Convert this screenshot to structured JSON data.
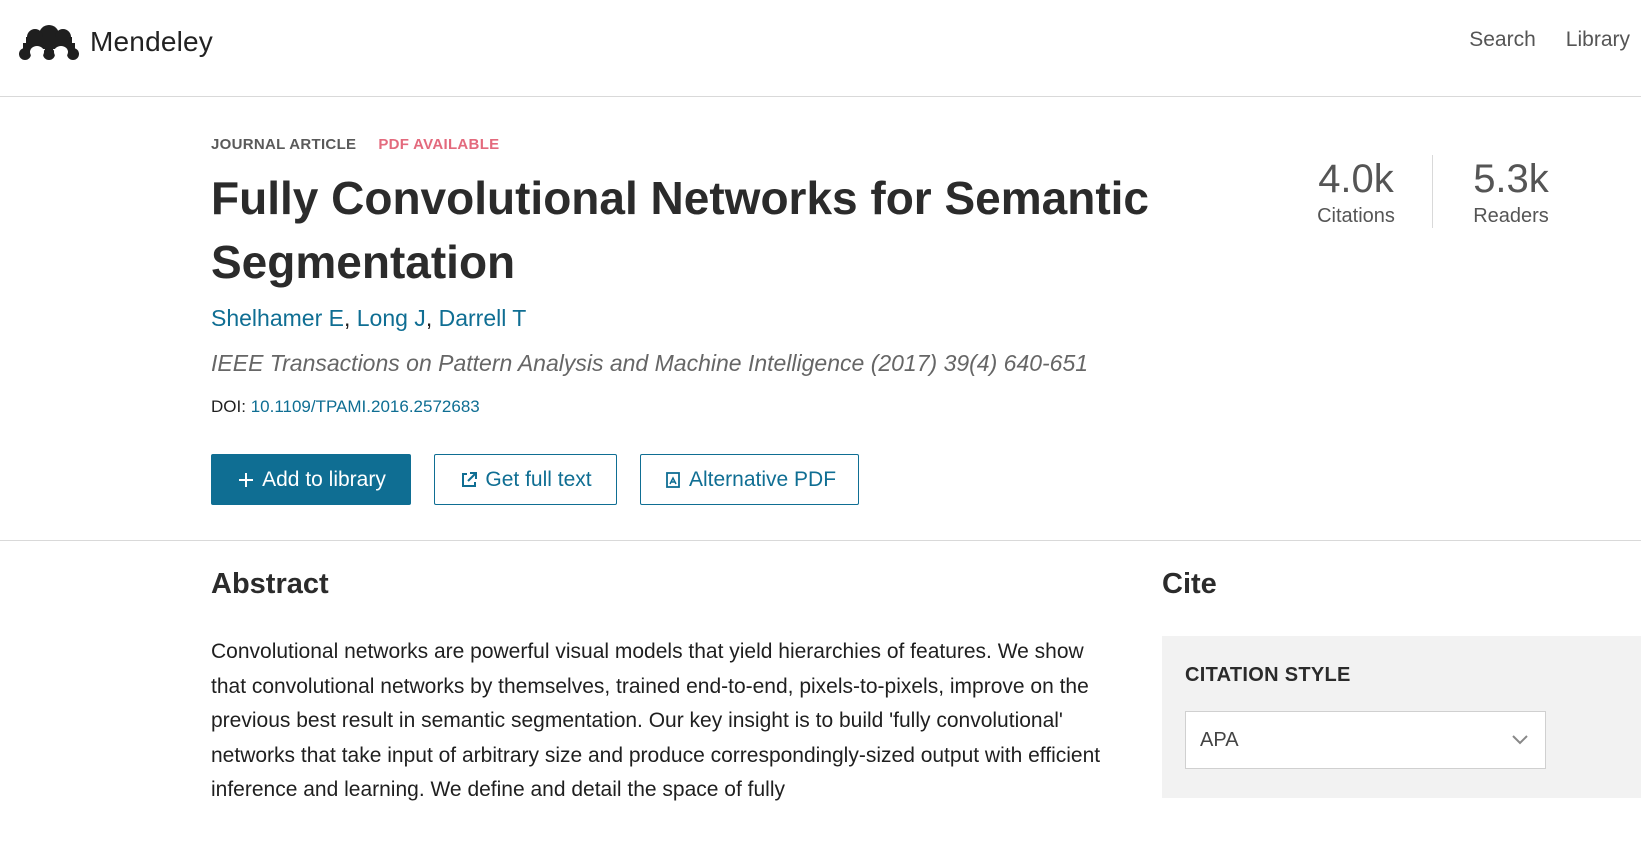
{
  "header": {
    "brand": "Mendeley",
    "nav": [
      "Search",
      "Library"
    ]
  },
  "article": {
    "type_tag": "JOURNAL ARTICLE",
    "pdf_tag": "PDF AVAILABLE",
    "title": "Fully Convolutional Networks for Semantic Segmentation",
    "authors": [
      "Shelhamer E",
      "Long J",
      "Darrell T"
    ],
    "journal": "IEEE Transactions on Pattern Analysis and Machine Intelligence (2017) 39(4) 640-651",
    "doi_label": "DOI:",
    "doi": "10.1109/TPAMI.2016.2572683"
  },
  "actions": {
    "add_to_library": "Add to library",
    "get_full_text": "Get full text",
    "alternative_pdf": "Alternative PDF"
  },
  "stats": {
    "citations_value": "4.0k",
    "citations_label": "Citations",
    "readers_value": "5.3k",
    "readers_label": "Readers"
  },
  "abstract": {
    "heading": "Abstract",
    "text": "Convolutional networks are powerful visual models that yield hierarchies of features. We show that convolutional networks by themselves, trained end-to-end, pixels-to-pixels, improve on the previous best result in semantic segmentation. Our key insight is to build 'fully convolutional' networks that take input of arbitrary size and produce correspondingly-sized output with efficient inference and learning. We define and detail the space of fully"
  },
  "cite": {
    "heading": "Cite",
    "style_label": "CITATION STYLE",
    "style_value": "APA"
  },
  "colors": {
    "accent": "#0f6e93",
    "pdf_tag": "#e36a7d"
  }
}
